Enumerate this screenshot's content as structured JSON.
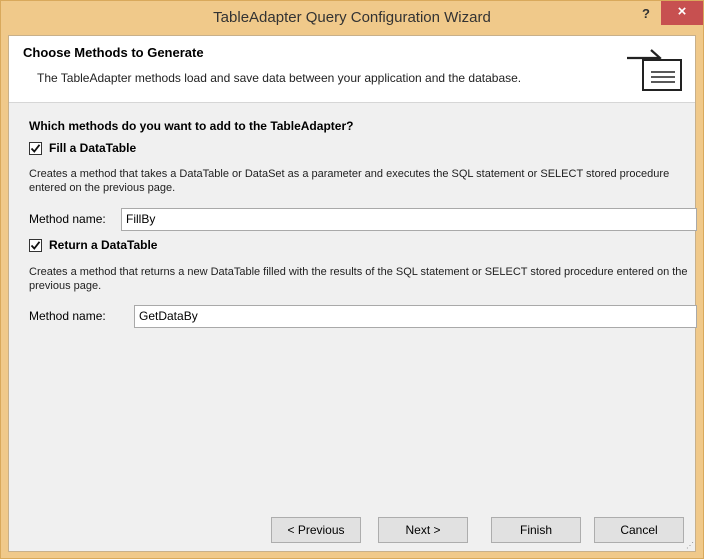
{
  "window": {
    "title": "TableAdapter Query Configuration Wizard",
    "help_label": "?",
    "close_label": "×"
  },
  "header": {
    "title": "Choose Methods to Generate",
    "subtitle": "The TableAdapter methods load and save data between your application and the database.",
    "icon": "wizard-arrow-icon"
  },
  "main": {
    "question": "Which methods do you want to add to the TableAdapter?",
    "fill": {
      "checked": true,
      "label": "Fill a DataTable",
      "description": "Creates a method that takes a DataTable or DataSet as a parameter and executes the SQL statement or SELECT stored procedure entered on the previous page.",
      "method_label": "Method name:",
      "method_value": "FillBy"
    },
    "return": {
      "checked": true,
      "label": "Return a DataTable",
      "description": "Creates a method that returns a new DataTable filled with the results of the SQL statement or SELECT stored procedure entered on the previous page.",
      "method_label": "Method name:",
      "method_value": "GetDataBy"
    }
  },
  "footer": {
    "previous": "< Previous",
    "next": "Next >",
    "finish": "Finish",
    "cancel": "Cancel"
  },
  "colors": {
    "titlebar": "#f0c98a",
    "close": "#c75050",
    "panel": "#f0f0f0",
    "header": "#ffffff"
  }
}
